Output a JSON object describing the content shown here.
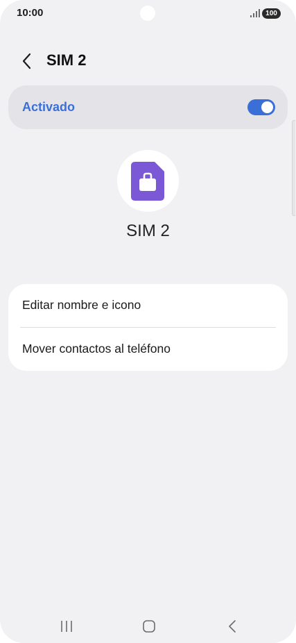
{
  "status_bar": {
    "time": "10:00",
    "battery": "100",
    "icons": [
      "signal-icon",
      "battery-icon"
    ]
  },
  "header": {
    "title": "SIM 2",
    "back_icon": "chevron-left-icon"
  },
  "master_switch": {
    "label": "Activado",
    "enabled": true,
    "accent_color": "#3a6fd8"
  },
  "sim": {
    "name": "SIM 2",
    "icon": "sim-work-icon",
    "icon_color": "#7b58d6"
  },
  "options": [
    {
      "label": "Editar nombre e icono"
    },
    {
      "label": "Mover contactos al teléfono"
    }
  ],
  "nav_bar": {
    "icons": [
      "recents-icon",
      "home-icon",
      "back-icon"
    ]
  }
}
